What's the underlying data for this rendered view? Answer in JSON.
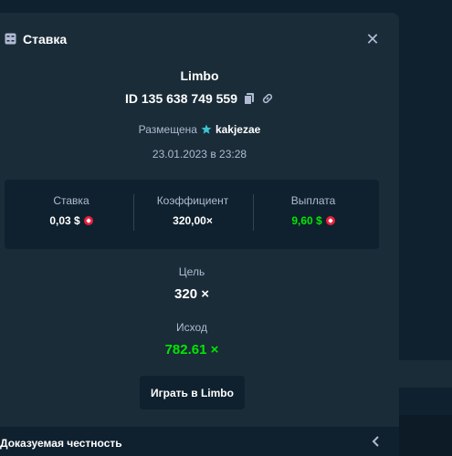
{
  "modal": {
    "title": "Ставка",
    "game_name": "Limbo",
    "bet_id": "ID 135 638 749 559",
    "placed_label": "Размещена",
    "username": "kakjezae",
    "datetime": "23.01.2023 в 23:28",
    "stats": {
      "bet_label": "Ставка",
      "bet_value": "0,03 $",
      "multiplier_label": "Коэффициент",
      "multiplier_value": "320,00×",
      "payout_label": "Выплата",
      "payout_value": "9,60 $"
    },
    "target_label": "Цель",
    "target_value": "320 ×",
    "result_label": "Исход",
    "result_value": "782.61 ×",
    "play_button": "Играть в Limbo",
    "footer_label": "Доказуемая честность"
  },
  "colors": {
    "background": "#0f212e",
    "panel": "#1a2c38",
    "win_green": "#00e701",
    "coin_red": "#e91f3b"
  }
}
